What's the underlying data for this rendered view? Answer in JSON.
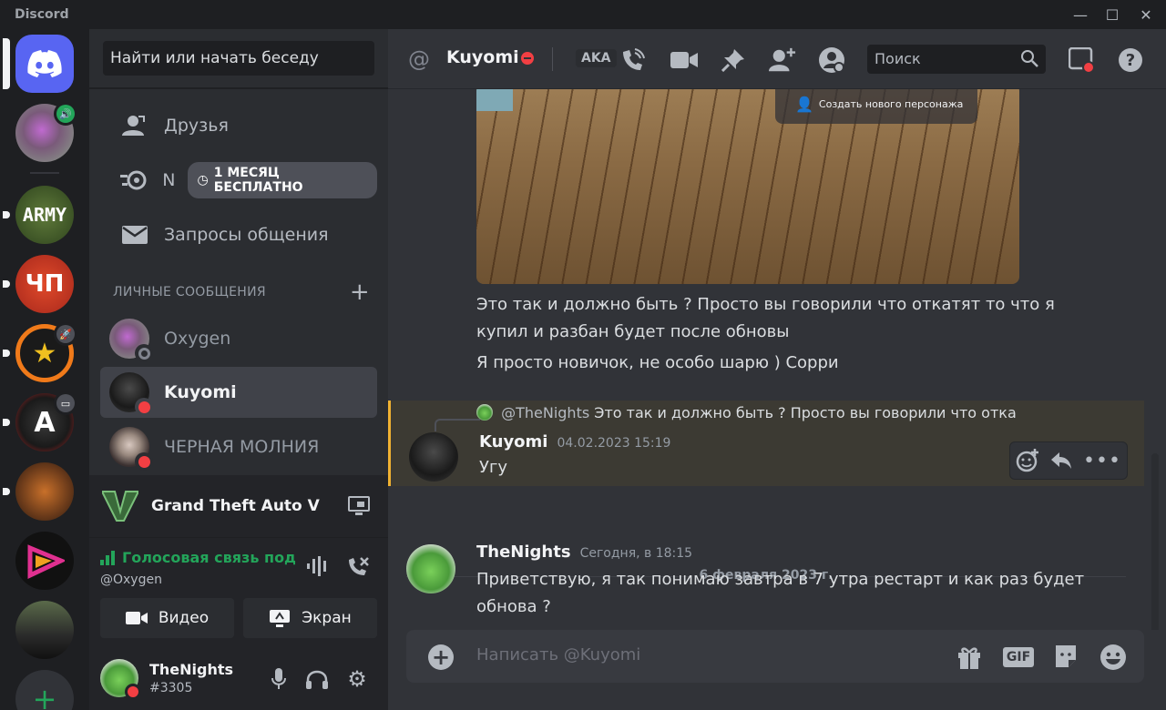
{
  "app": {
    "title": "Discord"
  },
  "window": {
    "minimize": "—",
    "maximize": "☐",
    "close": "✕"
  },
  "sidebar": {
    "search_placeholder": "Найти или начать беседу",
    "nav": [
      {
        "label": "Друзья",
        "icon": "friends-icon"
      },
      {
        "label": "N",
        "icon": "nitro-icon",
        "promo": "1 МЕСЯЦ БЕСПЛАТНО"
      },
      {
        "label": "Запросы общения",
        "icon": "mail-icon"
      }
    ],
    "dm_header": "ЛИЧНЫЕ СООБЩЕНИЯ",
    "dms": [
      {
        "name": "Oxygen",
        "status": "offline"
      },
      {
        "name": "Kuyomi",
        "status": "dnd",
        "active": true
      },
      {
        "name": "ЧЕРНАЯ МОЛНИЯ",
        "status": "dnd"
      }
    ]
  },
  "servers": [
    {
      "name": "ARMY",
      "label": "ARMY"
    },
    {
      "name": "ЧП",
      "label": "ЧП"
    }
  ],
  "activity": {
    "game": "Grand Theft Auto V"
  },
  "voice": {
    "status": "Голосовая связь под",
    "channel": "@Oxygen",
    "video_label": "Видео",
    "screen_label": "Экран"
  },
  "user": {
    "name": "TheNights",
    "tag": "#3305"
  },
  "chat": {
    "recipient": "Kuyomi",
    "search_placeholder": "Поиск",
    "aka": "AKA",
    "photo_overlay": "Создать нового персонажа",
    "messages_prev": [
      "Это так и должно быть ? Просто вы говорили что откатят то что я",
      "купил и разбан будет после обновы",
      "Я просто новичок, не особо шарю ) Сорри"
    ],
    "reply": {
      "to": "@TheNights",
      "snippet": "Это так и должно быть ? Просто вы говорили что откат",
      "author": "Kuyomi",
      "time": "04.02.2023 15:19",
      "text": "Угу"
    },
    "date_divider": "6 февраля 2023 г.",
    "last": {
      "author": "TheNights",
      "time": "Сегодня, в 18:15",
      "lines": [
        "Приветствую, я так понимаю завтра в 7 утра рестарт и как раз будет",
        "обнова ?"
      ]
    },
    "composer_placeholder": "Написать @Kuyomi",
    "gif_label": "GIF"
  },
  "colors": {
    "accent": "#5865f2",
    "dnd": "#f23f43",
    "online": "#23a55a",
    "highlight": "#f0b232"
  }
}
